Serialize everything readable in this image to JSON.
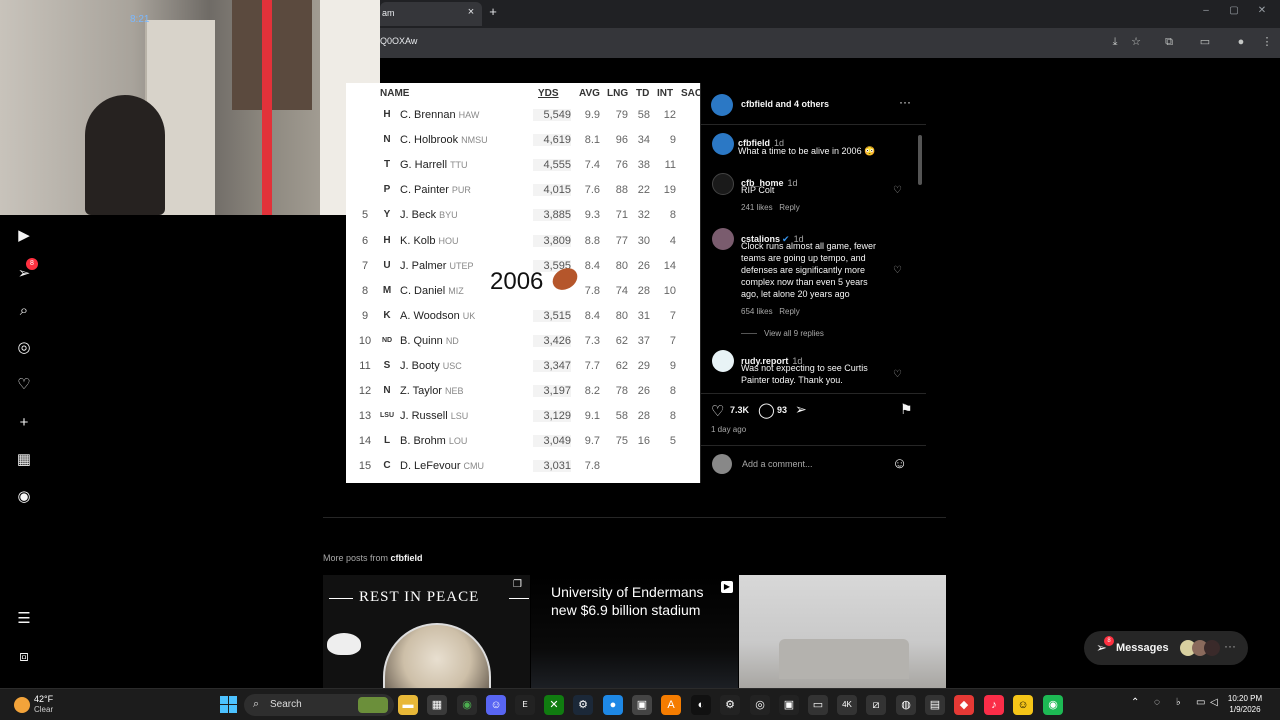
{
  "browser": {
    "tab_title": "am",
    "tab_close": "×",
    "new_tab": "+",
    "url": "Q0OXAw",
    "window_minimize": "–",
    "window_maximize": "▢",
    "window_close": "✕"
  },
  "webcam": {
    "clock": "8:21"
  },
  "sidebar": {
    "notifications_badge": "8"
  },
  "stats_table": {
    "headers": {
      "name": "NAME",
      "yds": "YDS",
      "avg": "AVG",
      "lng": "LNG",
      "td": "TD",
      "int": "INT",
      "sack": "SAC"
    },
    "overlay_text": "2006",
    "rows": [
      {
        "rank": "",
        "logo": "H",
        "name": "C. Brennan",
        "team": "HAW",
        "yds": "5,549",
        "avg": "9.9",
        "lng": "79",
        "td": "58",
        "int": "12"
      },
      {
        "rank": "",
        "logo": "N",
        "name": "C. Holbrook",
        "team": "NMSU",
        "yds": "4,619",
        "avg": "8.1",
        "lng": "96",
        "td": "34",
        "int": "9"
      },
      {
        "rank": "",
        "logo": "T",
        "name": "G. Harrell",
        "team": "TTU",
        "yds": "4,555",
        "avg": "7.4",
        "lng": "76",
        "td": "38",
        "int": "11"
      },
      {
        "rank": "",
        "logo": "P",
        "name": "C. Painter",
        "team": "PUR",
        "yds": "4,015",
        "avg": "7.6",
        "lng": "88",
        "td": "22",
        "int": "19"
      },
      {
        "rank": "5",
        "logo": "Y",
        "name": "J. Beck",
        "team": "BYU",
        "yds": "3,885",
        "avg": "9.3",
        "lng": "71",
        "td": "32",
        "int": "8"
      },
      {
        "rank": "6",
        "logo": "H",
        "name": "K. Kolb",
        "team": "HOU",
        "yds": "3,809",
        "avg": "8.8",
        "lng": "77",
        "td": "30",
        "int": "4"
      },
      {
        "rank": "7",
        "logo": "U",
        "name": "J. Palmer",
        "team": "UTEP",
        "yds": "3,595",
        "avg": "8.4",
        "lng": "80",
        "td": "26",
        "int": "14"
      },
      {
        "rank": "8",
        "logo": "M",
        "name": "C. Daniel",
        "team": "MIZ",
        "yds": "",
        "avg": "7.8",
        "lng": "74",
        "td": "28",
        "int": "10"
      },
      {
        "rank": "9",
        "logo": "K",
        "name": "A. Woodson",
        "team": "UK",
        "yds": "3,515",
        "avg": "8.4",
        "lng": "80",
        "td": "31",
        "int": "7"
      },
      {
        "rank": "10",
        "logo": "ND",
        "name": "B. Quinn",
        "team": "ND",
        "yds": "3,426",
        "avg": "7.3",
        "lng": "62",
        "td": "37",
        "int": "7"
      },
      {
        "rank": "11",
        "logo": "S",
        "name": "J. Booty",
        "team": "USC",
        "yds": "3,347",
        "avg": "7.7",
        "lng": "62",
        "td": "29",
        "int": "9"
      },
      {
        "rank": "12",
        "logo": "N",
        "name": "Z. Taylor",
        "team": "NEB",
        "yds": "3,197",
        "avg": "8.2",
        "lng": "78",
        "td": "26",
        "int": "8"
      },
      {
        "rank": "13",
        "logo": "LSU",
        "name": "J. Russell",
        "team": "LSU",
        "yds": "3,129",
        "avg": "9.1",
        "lng": "58",
        "td": "28",
        "int": "8"
      },
      {
        "rank": "14",
        "logo": "L",
        "name": "B. Brohm",
        "team": "LOU",
        "yds": "3,049",
        "avg": "9.7",
        "lng": "75",
        "td": "16",
        "int": "5"
      },
      {
        "rank": "15",
        "logo": "C",
        "name": "D. LeFevour",
        "team": "CMU",
        "yds": "3,031",
        "avg": "7.8",
        "lng": "",
        "td": "",
        "int": ""
      }
    ]
  },
  "comments_panel": {
    "header_user": "cfbfield",
    "header_rest": "and 4 others",
    "more_label": "···",
    "caption": {
      "user": "cfbfield",
      "time": "1d",
      "text": "What a time to be alive in 2006 😳"
    },
    "comments": [
      {
        "user": "cfb_home",
        "time": "1d",
        "text": "RIP Colt",
        "likes": "241 likes",
        "reply": "Reply"
      },
      {
        "user": "cstalions",
        "time": "1d",
        "text": "Clock runs almost all game, fewer teams are going up tempo, and defenses are significantly more complex now than even 5 years ago, let alone 20 years ago",
        "likes": "654 likes",
        "reply": "Reply",
        "view_replies": "View all 9 replies"
      },
      {
        "user": "rudy.report",
        "time": "1d",
        "text": "Was not expecting to see Curtis Painter today. Thank you."
      }
    ],
    "like_count": "7.3K",
    "comment_count": "93",
    "posted": "1 day ago",
    "add_comment_placeholder": "Add a comment..."
  },
  "more_posts": {
    "label": "More posts from",
    "user": "cfbfield",
    "thumb1_text": "REST IN PEACE",
    "thumb2_text": "University of Endermans new $6.9 billion stadium"
  },
  "messages": {
    "label": "Messages",
    "badge": "8"
  },
  "taskbar": {
    "weather_temp": "42°F",
    "weather_cond": "Clear",
    "search_label": "Search",
    "time": "10:20 PM",
    "date": "1/9/2026"
  }
}
